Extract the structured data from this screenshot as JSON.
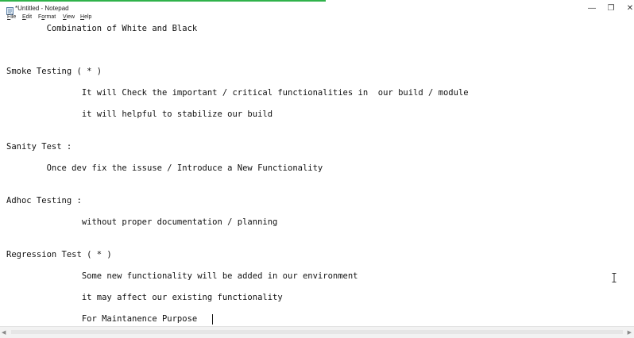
{
  "window": {
    "title": "*Untitled - Notepad",
    "accent_color": "#2fb24a"
  },
  "controls": {
    "minimize_glyph": "—",
    "maximize_glyph": "❐",
    "close_glyph": "✕"
  },
  "menu": {
    "file": {
      "mnemonic": "F",
      "rest": "ile"
    },
    "edit": {
      "mnemonic": "E",
      "rest": "dit"
    },
    "format": {
      "pre": "F",
      "mnemonic": "o",
      "rest": "rmat"
    },
    "view": {
      "mnemonic": "V",
      "rest": "iew"
    },
    "help": {
      "mnemonic": "H",
      "rest": "elp"
    }
  },
  "editor": {
    "lines": [
      "        Combination of White and Black",
      "Smoke Testing ( * )",
      "               It will Check the important / critical functionalities in  our build / module",
      "               it will helpful to stabilize our build",
      "Sanity Test :",
      "        Once dev fix the issuse / Introduce a New Functionality",
      "Adhoc Testing :",
      "               without proper documentation / planning",
      "Regression Test ( * )",
      "               Some new functionality will be added in our environment",
      "               it may affect our existing functionality",
      "               For Maintanence Purpose "
    ]
  },
  "scrollbar": {
    "left_arrow": "◀",
    "right_arrow": "▶"
  }
}
